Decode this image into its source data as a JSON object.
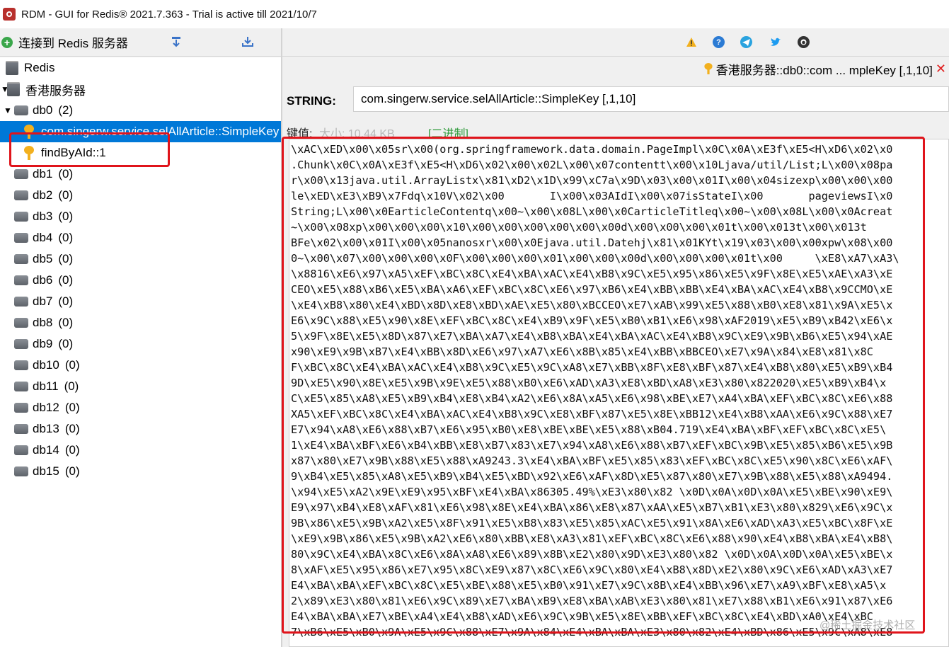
{
  "window": {
    "title": "RDM - GUI for Redis® 2021.7.363  -  Trial is active till 2021/10/7"
  },
  "left_toolbar": {
    "connect_label": "连接到 Redis 服务器"
  },
  "tree": {
    "root_label": "Redis",
    "server_label": "香港服务器",
    "db0": {
      "label": "db0",
      "count": "(2)"
    },
    "keys": [
      {
        "label": "com.singerw.service.selAllArticle::SimpleKey"
      },
      {
        "label": "findByAId::1"
      }
    ],
    "databases": [
      {
        "label": "db1",
        "count": "(0)"
      },
      {
        "label": "db2",
        "count": "(0)"
      },
      {
        "label": "db3",
        "count": "(0)"
      },
      {
        "label": "db4",
        "count": "(0)"
      },
      {
        "label": "db5",
        "count": "(0)"
      },
      {
        "label": "db6",
        "count": "(0)"
      },
      {
        "label": "db7",
        "count": "(0)"
      },
      {
        "label": "db8",
        "count": "(0)"
      },
      {
        "label": "db9",
        "count": "(0)"
      },
      {
        "label": "db10",
        "count": "(0)"
      },
      {
        "label": "db11",
        "count": "(0)"
      },
      {
        "label": "db12",
        "count": "(0)"
      },
      {
        "label": "db13",
        "count": "(0)"
      },
      {
        "label": "db14",
        "count": "(0)"
      },
      {
        "label": "db15",
        "count": "(0)"
      }
    ]
  },
  "tab": {
    "label": "香港服务器::db0::com ... mpleKey [,1,10]",
    "close": "✕"
  },
  "editor": {
    "type_label": "STRING:",
    "key_name": "com.singerw.service.selAllArticle::SimpleKey [,1,10]",
    "value_label": "键值:",
    "size_label": "大小: 10.44 KB",
    "binary_label": "[二进制]",
    "value_lines": [
      "\\xAC\\xED\\x00\\x05sr\\x00(org.springframework.data.domain.PageImpl\\x0C\\x0A\\xE3f\\xE5<H\\xD6\\x02\\x0",
      ".Chunk\\x0C\\x0A\\xE3f\\xE5<H\\xD6\\x02\\x00\\x02L\\x00\\x07contentt\\x00\\x10Ljava/util/List;L\\x00\\x08pa",
      "r\\x00\\x13java.util.ArrayListx\\x81\\xD2\\x1D\\x99\\xC7a\\x9D\\x03\\x00\\x01I\\x00\\x04sizexp\\x00\\x00\\x00",
      "le\\xED\\xE3\\xB9\\x7Fdq\\x10V\\x02\\x00       I\\x00\\x03AIdI\\x00\\x07isStateI\\x00       pageviewsI\\x0",
      "String;L\\x00\\x0EarticleContentq\\x00~\\x00\\x08L\\x00\\x0CarticleTitleq\\x00~\\x00\\x08L\\x00\\x0Acreat",
      "~\\x00\\x08xp\\x00\\x00\\x00\\x10\\x00\\x00\\x00\\x00\\x00\\x00d\\x00\\x00\\x00\\x01t\\x00\\x013t\\x00\\x013t",
      "BFe\\x02\\x00\\x01I\\x00\\x05nanosxr\\x00\\x0Ejava.util.Datehj\\x81\\x01KYt\\x19\\x03\\x00\\x00xpw\\x08\\x00",
      "0~\\x00\\x07\\x00\\x00\\x00\\x0F\\x00\\x00\\x00\\x01\\x00\\x00\\x00d\\x00\\x00\\x00\\x01t\\x00     \\xE8\\xA7\\xA3\\",
      "\\x8816\\xE6\\x97\\xA5\\xEF\\xBC\\x8C\\xE4\\xBA\\xAC\\xE4\\xB8\\x9C\\xE5\\x95\\x86\\xE5\\x9F\\x8E\\xE5\\xAE\\xA3\\xE",
      "CEO\\xE5\\x88\\xB6\\xE5\\xBA\\xA6\\xEF\\xBC\\x8C\\xE6\\x97\\xB6\\xE4\\xBB\\xBB\\xE4\\xBA\\xAC\\xE4\\xB8\\x9CCMO\\xE",
      "\\xE4\\xB8\\x80\\xE4\\xBD\\x8D\\xE8\\xBD\\xAE\\xE5\\x80\\xBCCEO\\xE7\\xAB\\x99\\xE5\\x88\\xB0\\xE8\\x81\\x9A\\xE5\\x",
      "E6\\x9C\\x88\\xE5\\x90\\x8E\\xEF\\xBC\\x8C\\xE4\\xB9\\x9F\\xE5\\xB0\\xB1\\xE6\\x98\\xAF2019\\xE5\\xB9\\xB42\\xE6\\x",
      "5\\x9F\\x8E\\xE5\\x8D\\x87\\xE7\\xBA\\xA7\\xE4\\xB8\\xBA\\xE4\\xBA\\xAC\\xE4\\xB8\\x9C\\xE9\\x9B\\xB6\\xE5\\x94\\xAE",
      "x90\\xE9\\x9B\\xB7\\xE4\\xBB\\x8D\\xE6\\x97\\xA7\\xE6\\x8B\\x85\\xE4\\xBB\\xBBCEO\\xE7\\x9A\\x84\\xE8\\x81\\x8C",
      "F\\xBC\\x8C\\xE4\\xBA\\xAC\\xE4\\xB8\\x9C\\xE5\\x9C\\xA8\\xE7\\xBB\\x8F\\xE8\\xBF\\x87\\xE4\\xB8\\x80\\xE5\\xB9\\xB4",
      "9D\\xE5\\x90\\x8E\\xE5\\x9B\\x9E\\xE5\\x88\\xB0\\xE6\\xAD\\xA3\\xE8\\xBD\\xA8\\xE3\\x80\\x822020\\xE5\\xB9\\xB4\\x",
      "C\\xE5\\x85\\xA8\\xE5\\xB9\\xB4\\xE8\\xB4\\xA2\\xE6\\x8A\\xA5\\xE6\\x98\\xBE\\xE7\\xA4\\xBA\\xEF\\xBC\\x8C\\xE6\\x88",
      "XA5\\xEF\\xBC\\x8C\\xE4\\xBA\\xAC\\xE4\\xB8\\x9C\\xE8\\xBF\\x87\\xE5\\x8E\\xBB12\\xE4\\xB8\\xAA\\xE6\\x9C\\x88\\xE7",
      "E7\\x94\\xA8\\xE6\\x88\\xB7\\xE6\\x95\\xB0\\xE8\\xBE\\xBE\\xE5\\x88\\xB04.719\\xE4\\xBA\\xBF\\xEF\\xBC\\x8C\\xE5\\",
      "1\\xE4\\xBA\\xBF\\xE6\\xB4\\xBB\\xE8\\xB7\\x83\\xE7\\x94\\xA8\\xE6\\x88\\xB7\\xEF\\xBC\\x9B\\xE5\\x85\\xB6\\xE5\\x9B",
      "x87\\x80\\xE7\\x9B\\x88\\xE5\\x88\\xA9243.3\\xE4\\xBA\\xBF\\xE5\\x85\\x83\\xEF\\xBC\\x8C\\xE5\\x90\\x8C\\xE6\\xAF\\",
      "9\\xB4\\xE5\\x85\\xA8\\xE5\\xB9\\xB4\\xE5\\xBD\\x92\\xE6\\xAF\\x8D\\xE5\\x87\\x80\\xE7\\x9B\\x88\\xE5\\x88\\xA9494.",
      "\\x94\\xE5\\xA2\\x9E\\xE9\\x95\\xBF\\xE4\\xBA\\x86305.49%\\xE3\\x80\\x82 \\x0D\\x0A\\x0D\\x0A\\xE5\\xBE\\x90\\xE9\\",
      "E9\\x97\\xB4\\xE8\\xAF\\x81\\xE6\\x98\\x8E\\xE4\\xBA\\x86\\xE8\\x87\\xAA\\xE5\\xB7\\xB1\\xE3\\x80\\x829\\xE6\\x9C\\x",
      "9B\\x86\\xE5\\x9B\\xA2\\xE5\\x8F\\x91\\xE5\\xB8\\x83\\xE5\\x85\\xAC\\xE5\\x91\\x8A\\xE6\\xAD\\xA3\\xE5\\xBC\\x8F\\xE",
      "\\xE9\\x9B\\x86\\xE5\\x9B\\xA2\\xE6\\x80\\xBB\\xE8\\xA3\\x81\\xEF\\xBC\\x8C\\xE6\\x88\\x90\\xE4\\xB8\\xBA\\xE4\\xB8\\",
      "80\\x9C\\xE4\\xBA\\x8C\\xE6\\x8A\\xA8\\xE6\\x89\\x8B\\xE2\\x80\\x9D\\xE3\\x80\\x82 \\x0D\\x0A\\x0D\\x0A\\xE5\\xBE\\x",
      "8\\xAF\\xE5\\x95\\x86\\xE7\\x95\\x8C\\xE9\\x87\\x8C\\xE6\\x9C\\x80\\xE4\\xB8\\x8D\\xE2\\x80\\x9C\\xE6\\xAD\\xA3\\xE7",
      "E4\\xBA\\xBA\\xEF\\xBC\\x8C\\xE5\\xBE\\x88\\xE5\\xB0\\x91\\xE7\\x9C\\x8B\\xE4\\xBB\\x96\\xE7\\xA9\\xBF\\xE8\\xA5\\x",
      "2\\x89\\xE3\\x80\\x81\\xE6\\x9C\\x89\\xE7\\xBA\\xB9\\xE8\\xBA\\xAB\\xE3\\x80\\x81\\xE7\\x88\\xB1\\xE6\\x91\\x87\\xE6",
      "E4\\xBA\\xBA\\xE7\\xBE\\xA4\\xE4\\xB8\\xAD\\xE6\\x9C\\x9B\\xE5\\x8E\\xBB\\xEF\\xBC\\x8C\\xE4\\xBD\\xA0\\xE4\\xBC",
      "7\\xB6\\xE5\\xB0\\x9A\\xE5\\x9C\\x88\\xE7\\x9A\\x84\\xE4\\xBA\\xBA\\xE3\\x80\\x82\\xE4\\xBD\\x86\\xE5\\x9C\\xA8\\xE8"
    ]
  },
  "watermark": "@稀土掘金技术社区"
}
